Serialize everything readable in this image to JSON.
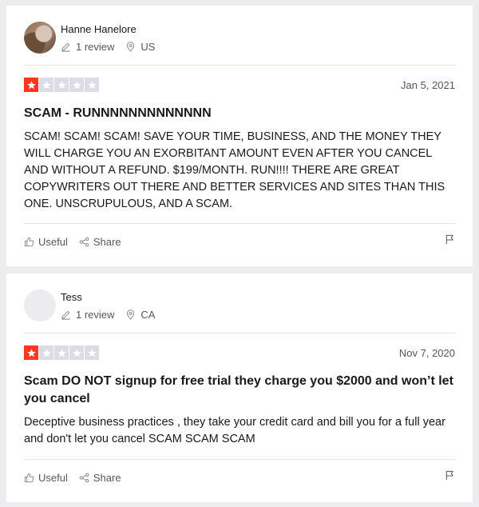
{
  "theme": {
    "star_filled": "#ff3722",
    "star_empty": "#dcdce6",
    "card_bg": "#ffffff",
    "page_bg": "#ededf0"
  },
  "reviews": [
    {
      "reviewer": {
        "name": "Hanne Hanelore",
        "avatar": "photo",
        "review_count": "1 review",
        "country": "US"
      },
      "rating": 1,
      "rating_max": 5,
      "date": "Jan 5, 2021",
      "title": "SCAM - RUNNNNNNNNNNNNN",
      "body": "SCAM! SCAM! SCAM! SAVE YOUR TIME, BUSINESS, AND THE MONEY THEY WILL CHARGE YOU AN EXORBITANT AMOUNT EVEN AFTER YOU CANCEL AND WITHOUT A REFUND. $199/MONTH. RUN!!!! THERE ARE GREAT COPYWRITERS OUT THERE AND BETTER SERVICES AND SITES THAN THIS ONE. UNSCRUPULOUS, AND A SCAM.",
      "actions": {
        "useful": "Useful",
        "share": "Share"
      }
    },
    {
      "reviewer": {
        "name": "Tess",
        "avatar": "empty",
        "review_count": "1 review",
        "country": "CA"
      },
      "rating": 1,
      "rating_max": 5,
      "date": "Nov 7, 2020",
      "title": "Scam DO NOT signup for free trial they charge you $2000 and won’t let you cancel",
      "body": "Deceptive business practices , they take your credit card and bill you for a full year and don't let you cancel SCAM SCAM SCAM",
      "actions": {
        "useful": "Useful",
        "share": "Share"
      }
    }
  ],
  "icons": {
    "review_count": "pencil-icon",
    "location": "location-pin-icon",
    "useful": "thumbs-up-icon",
    "share": "share-icon",
    "report": "flag-icon",
    "star": "star-icon"
  }
}
